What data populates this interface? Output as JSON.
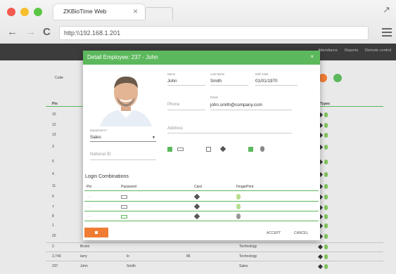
{
  "browser": {
    "tab_title": "ZKBioTime Web",
    "tab_close": "×",
    "url": "http:\\\\192.168.1.201",
    "back_glyph": "←",
    "forward_glyph": "→",
    "reload_glyph": "C",
    "expand_glyph": "↗"
  },
  "topnav": {
    "items": [
      "Attendance",
      "Reports",
      "Remote control"
    ]
  },
  "background_page": {
    "search_label": "Code",
    "table_header": [
      "Pin",
      "Types"
    ],
    "pins": [
      "10",
      "12",
      "13",
      "3",
      "5",
      "4",
      "11",
      "6",
      "7",
      "8",
      "1",
      "20",
      "2",
      "2,749",
      "237"
    ],
    "rows": [
      {
        "pin": "2",
        "name": "Bruno",
        "dept": "Technology"
      },
      {
        "pin": "2,749",
        "name": "larry",
        "last": "lo",
        "code": "86",
        "dept": "Technology"
      },
      {
        "pin": "237",
        "name": "John",
        "last": "Smith",
        "dept": "Sales"
      }
    ]
  },
  "modal": {
    "title": "Detail Employee: 237 - John",
    "close": "×",
    "name_label": "Name",
    "name_value": "John",
    "lastname_label": "Last Name",
    "lastname_value": "Smith",
    "birth_label": "Birth Date",
    "birth_value": "01/01/1970",
    "phone_placeholder": "Phone",
    "email_label": "Email",
    "email_value": "john.smith@company.com",
    "department_label": "Department *",
    "department_value": "Sales",
    "address_placeholder": "Address",
    "national_id_placeholder": "National ID",
    "login_section": "Login Combinations",
    "table_headers": [
      "Pin",
      "Password",
      "Card",
      "FingerPrint"
    ],
    "login_rows": [
      {
        "pin": "·····",
        "password": "***",
        "card": true,
        "finger": "green"
      },
      {
        "pin": "·····",
        "password": "***",
        "card": true,
        "finger": "green"
      },
      {
        "pin": "·····",
        "password": "***",
        "card": true,
        "finger": "gray"
      }
    ],
    "accept": "ACCEPT",
    "cancel": "CANCEL"
  },
  "colors": {
    "header_green": "#5cb85c",
    "accent_orange": "#f07c33",
    "topbar": "#3c3c3c"
  }
}
